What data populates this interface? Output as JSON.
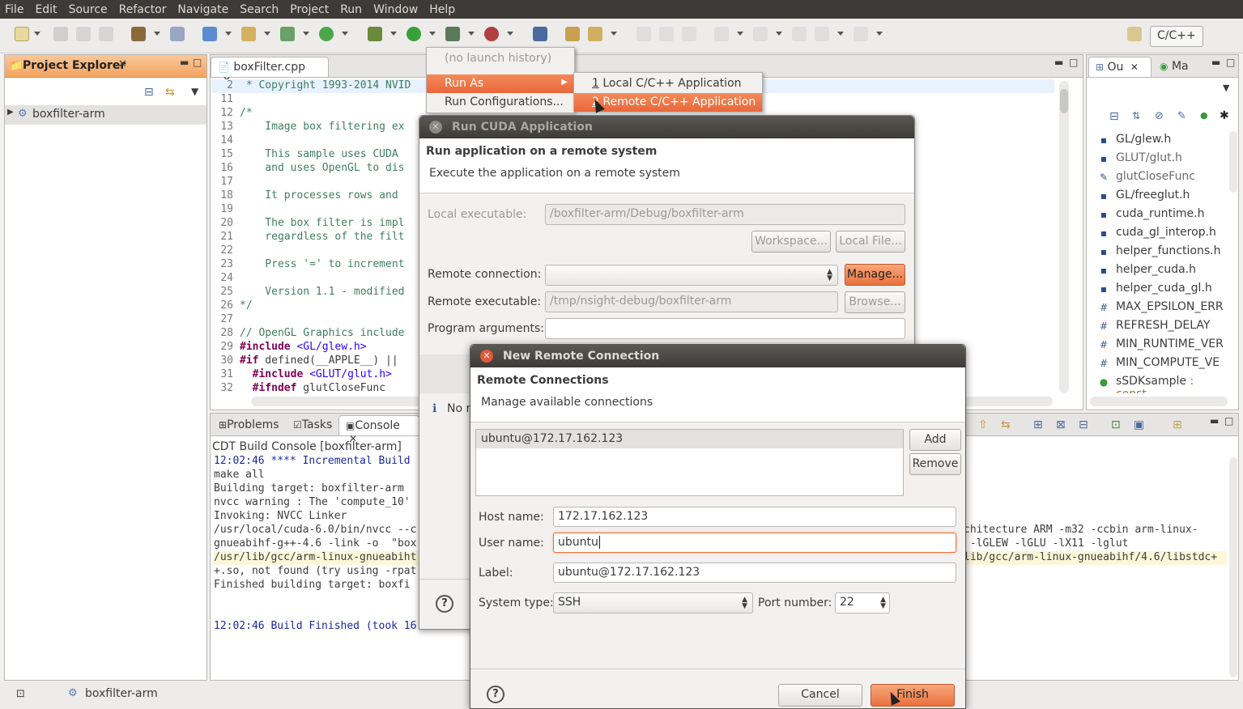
{
  "menubar": [
    "File",
    "Edit",
    "Source",
    "Refactor",
    "Navigate",
    "Search",
    "Project",
    "Run",
    "Window",
    "Help"
  ],
  "perspective": "C/C++",
  "project_explorer": {
    "title": "Project Explorer",
    "item": "boxfilter-arm"
  },
  "editor": {
    "tab": "boxFilter.cpp",
    "lines": [
      {
        "n": "2",
        "t": " * Copyright 1993-2014 NVID",
        "c": "cm"
      },
      {
        "n": "11",
        "t": "",
        "c": ""
      },
      {
        "n": "12",
        "t": "/*",
        "c": "cm"
      },
      {
        "n": "13",
        "t": "    Image box filtering ex",
        "c": "cm"
      },
      {
        "n": "14",
        "t": "",
        "c": ""
      },
      {
        "n": "15",
        "t": "    This sample uses CUDA",
        "c": "cm"
      },
      {
        "n": "16",
        "t": "    and uses OpenGL to dis",
        "c": "cm"
      },
      {
        "n": "17",
        "t": "",
        "c": ""
      },
      {
        "n": "18",
        "t": "    It processes rows and",
        "c": "cm"
      },
      {
        "n": "19",
        "t": "",
        "c": ""
      },
      {
        "n": "20",
        "t": "    The box filter is impl",
        "c": "cm"
      },
      {
        "n": "21",
        "t": "    regardless of the filt",
        "c": "cm"
      },
      {
        "n": "22",
        "t": "",
        "c": ""
      },
      {
        "n": "23",
        "t": "    Press '=' to increment",
        "c": "cm"
      },
      {
        "n": "24",
        "t": "",
        "c": ""
      },
      {
        "n": "25",
        "t": "    Version 1.1 - modified",
        "c": "cm"
      },
      {
        "n": "26",
        "t": "*/",
        "c": "cm"
      },
      {
        "n": "27",
        "t": "",
        "c": ""
      },
      {
        "n": "28",
        "t": "// OpenGL Graphics include",
        "c": "cm"
      }
    ],
    "l29_kw": "#include",
    "l29_str": " <GL/glew.h>",
    "l30_kw": "#if",
    "l30_rest": " defined(__APPLE__) ||",
    "l31_kw": "  #include",
    "l31_str": " <GLUT/glut.h>",
    "l32_kw": "  #ifndef",
    "l32_rest": " glutCloseFunc",
    "n29": "29",
    "n30": "30",
    "n31": "31",
    "n32": "32"
  },
  "outline": {
    "tab1": "Ou",
    "tab2": "Ma",
    "items": [
      {
        "icon": "▪",
        "t": "GL/glew.h"
      },
      {
        "icon": "▪",
        "t": "GLUT/glut.h"
      },
      {
        "icon": "✎",
        "t": "glutCloseFunc"
      },
      {
        "icon": "▪",
        "t": "GL/freeglut.h"
      },
      {
        "icon": "▪",
        "t": "cuda_runtime.h"
      },
      {
        "icon": "▪",
        "t": "cuda_gl_interop.h"
      },
      {
        "icon": "▪",
        "t": "helper_functions.h"
      },
      {
        "icon": "▪",
        "t": "helper_cuda.h"
      },
      {
        "icon": "▪",
        "t": "helper_cuda_gl.h"
      },
      {
        "icon": "#",
        "t": "MAX_EPSILON_ERR"
      },
      {
        "icon": "#",
        "t": "REFRESH_DELAY"
      },
      {
        "icon": "#",
        "t": "MIN_RUNTIME_VER"
      },
      {
        "icon": "#",
        "t": "MIN_COMPUTE_VE"
      },
      {
        "icon": "●",
        "t": "sSDKsample",
        "extra": " : const"
      }
    ]
  },
  "bottom_tabs": {
    "problems": "Problems",
    "tasks": "Tasks",
    "console": "Console"
  },
  "console": {
    "header": "CDT Build Console [boxfilter-arm]",
    "lines": [
      {
        "t": "12:02:46 **** Incremental Build",
        "c": "blue"
      },
      {
        "t": "make all",
        "c": ""
      },
      {
        "t": "Building target: boxfilter-arm",
        "c": ""
      },
      {
        "t": "nvcc warning : The 'compute_10'",
        "c": ""
      },
      {
        "t": "Invoking: NVCC Linker",
        "c": ""
      },
      {
        "t": "/usr/local/cuda-6.0/bin/nvcc --c",
        "c": ""
      },
      {
        "t": "gnueabihf-g++-4.6 -link -o  \"box",
        "c": ""
      },
      {
        "t": "/usr/lib/gcc/arm-linux-gnueabiht",
        "c": "yellow"
      },
      {
        "t": "+.so, not found (try using -rpat",
        "c": ""
      },
      {
        "t": "Finished building target: boxfi",
        "c": ""
      },
      {
        "t": "",
        "c": ""
      },
      {
        "t": "",
        "c": ""
      },
      {
        "t": "12:02:46 Build Finished (took 16",
        "c": "blue"
      }
    ],
    "right_lines": [
      {
        "t": "chitecture ARM -m32 -ccbin arm-linux-",
        "c": ""
      },
      {
        "t": " -lGLEW -lGLU -lX11 -lglut",
        "c": ""
      },
      {
        "t": "lib/gcc/arm-linux-gnueabihf/4.6/libstdc+",
        "c": "yellow"
      }
    ]
  },
  "statusbar": {
    "project": "boxfilter-arm"
  },
  "run_menu": {
    "history": "(no launch history)",
    "run_as": "Run As",
    "run_configs": "Run Configurations...",
    "sub1_num": "1",
    "sub1": " Local C/C++ Application",
    "sub2_num": "2",
    "sub2": " Remote C/C++ Application"
  },
  "run_cuda": {
    "title": "Run CUDA Application",
    "heading": "Run application on a remote system",
    "desc": "Execute the application on a remote system",
    "local_exe_label": "Local executable:",
    "local_exe": "/boxfilter-arm/Debug/boxfilter-arm",
    "workspace": "Workspace...",
    "local_file": "Local File...",
    "remote_conn_label": "Remote connection:",
    "manage": "Manage...",
    "remote_exe_label": "Remote executable:",
    "remote_exe": "/tmp/nsight-debug/boxfilter-arm",
    "browse": "Browse...",
    "args_label": "Program arguments:",
    "info": "No r"
  },
  "new_conn": {
    "title": "New Remote Connection",
    "heading": "Remote Connections",
    "desc": "Manage available connections",
    "list": [
      "ubuntu@172.17.162.123"
    ],
    "add": "Add",
    "remove": "Remove",
    "host_label": "Host name:",
    "host": "172.17.162.123",
    "user_label": "User name:",
    "user": "ubuntu",
    "label_label": "Label:",
    "label": "ubuntu@172.17.162.123",
    "systype_label": "System type:",
    "systype": "SSH",
    "port_label": "Port number:",
    "port": "22",
    "cancel": "Cancel",
    "finish": "Finish"
  }
}
